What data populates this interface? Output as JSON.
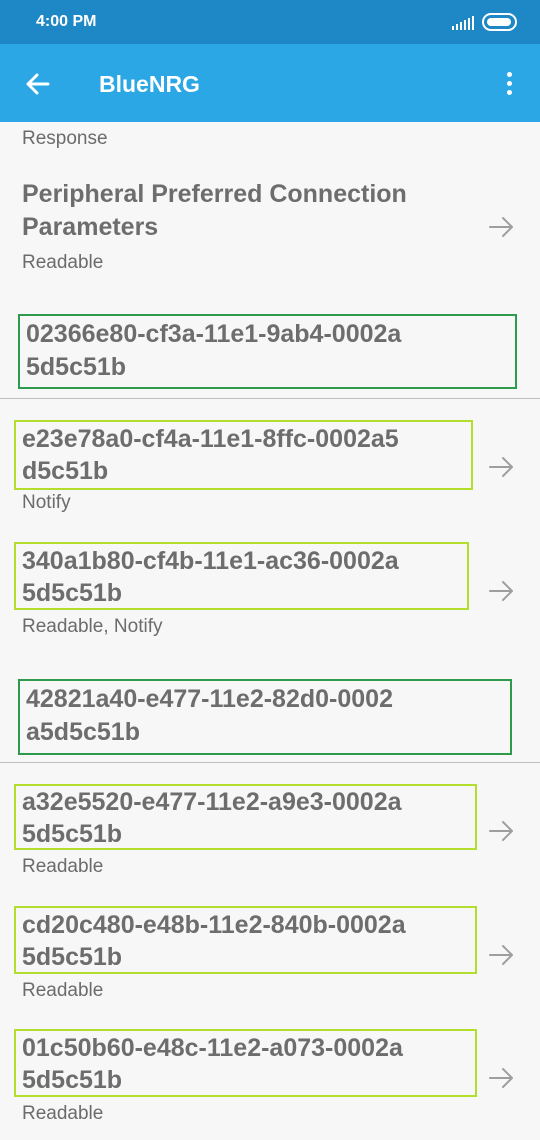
{
  "status": {
    "time": "4:00 PM"
  },
  "appbar": {
    "title": "BlueNRG"
  },
  "list": {
    "partial_props": "Response",
    "char_ppcp": {
      "title_line1": "Peripheral Preferred Connection",
      "title_line2": "Parameters",
      "props": "Readable"
    },
    "service1": {
      "uuid_line1": "02366e80-cf3a-11e1-9ab4-0002a",
      "uuid_line2": "5d5c51b"
    },
    "char_a": {
      "uuid_line1": "e23e78a0-cf4a-11e1-8ffc-0002a5",
      "uuid_line2": "d5c51b",
      "props": "Notify"
    },
    "char_b": {
      "uuid_line1": "340a1b80-cf4b-11e1-ac36-0002a",
      "uuid_line2": "5d5c51b",
      "props": "Readable, Notify"
    },
    "service2": {
      "uuid_line1": "42821a40-e477-11e2-82d0-0002",
      "uuid_line2": "a5d5c51b"
    },
    "char_c": {
      "uuid_line1": "a32e5520-e477-11e2-a9e3-0002a",
      "uuid_line2": "5d5c51b",
      "props": "Readable"
    },
    "char_d": {
      "uuid_line1": "cd20c480-e48b-11e2-840b-0002a",
      "uuid_line2": "5d5c51b",
      "props": "Readable"
    },
    "char_e": {
      "uuid_line1": "01c50b60-e48c-11e2-a073-0002a",
      "uuid_line2": "5d5c51b",
      "props": "Readable"
    }
  },
  "colors": {
    "statusbar": "#1e88c7",
    "appbar": "#2aa7e4",
    "highlight_service": "#2e9a4c",
    "highlight_characteristic": "#b4de2c"
  },
  "icons": {
    "back": "arrow-left-icon",
    "more": "more-vert-icon",
    "row_arrow": "arrow-right-icon"
  }
}
